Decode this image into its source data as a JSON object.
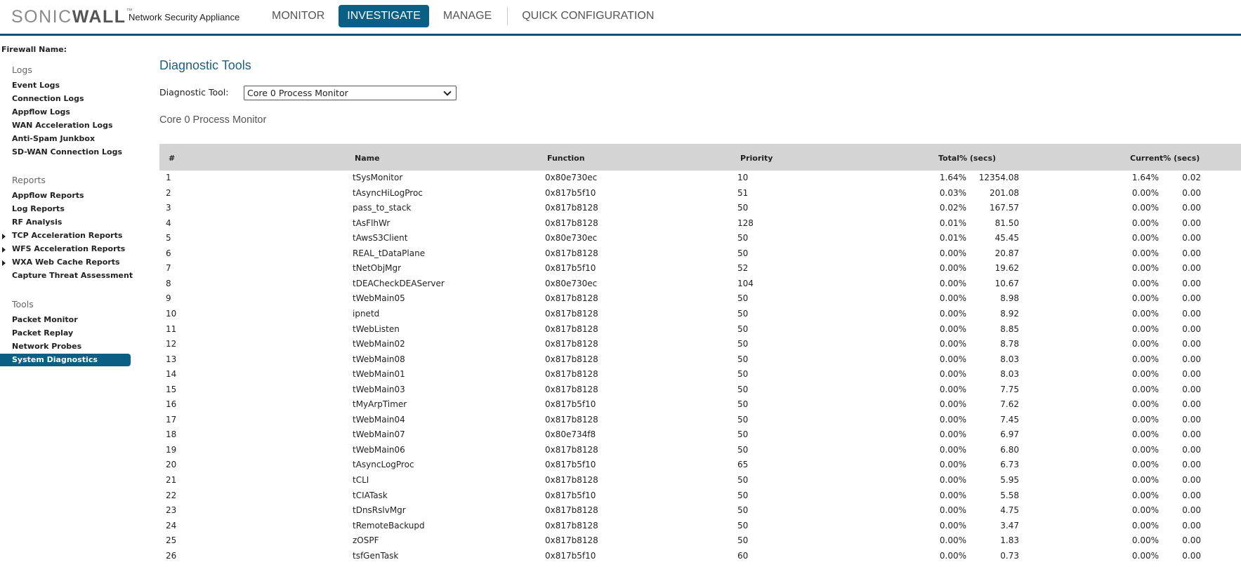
{
  "header": {
    "logo": "SONICWALL",
    "logo_parts": {
      "sonic": "SONIC",
      "wall": "WALL",
      "tm": "™"
    },
    "appliance": "Network Security Appliance",
    "nav": [
      "MONITOR",
      "INVESTIGATE",
      "MANAGE",
      "QUICK CONFIGURATION"
    ],
    "active_nav": "INVESTIGATE"
  },
  "sidebar": {
    "firewall_name_label": "Firewall Name:",
    "logs_heading": "Logs",
    "logs": [
      "Event Logs",
      "Connection Logs",
      "Appflow Logs",
      "WAN Acceleration Logs",
      "Anti-Spam Junkbox",
      "SD-WAN Connection Logs"
    ],
    "reports_heading": "Reports",
    "reports": [
      "Appflow Reports",
      "Log Reports",
      "RF Analysis",
      "TCP Acceleration Reports",
      "WFS Acceleration Reports",
      "WXA Web Cache Reports",
      "Capture Threat Assessment"
    ],
    "tools_heading": "Tools",
    "tools": [
      "Packet Monitor",
      "Packet Replay",
      "Network Probes",
      "System Diagnostics"
    ],
    "active_item": "System Diagnostics"
  },
  "main": {
    "title": "Diagnostic Tools",
    "tool_label": "Diagnostic Tool:",
    "tool_selected": "Core 0 Process Monitor",
    "subtitle": "Core 0 Process Monitor"
  },
  "table": {
    "headers": {
      "num": "#",
      "name": "Name",
      "function": "Function",
      "priority": "Priority",
      "total": "Total%  (secs)",
      "current": "Current%  (secs)"
    },
    "rows": [
      [
        "1",
        "tSysMonitor",
        "0x80e730ec",
        "10",
        "1.64%",
        "12354.08",
        "1.64%",
        "0.02"
      ],
      [
        "2",
        "tAsyncHiLogProc",
        "0x817b5f10",
        "51",
        "0.03%",
        "201.08",
        "0.00%",
        "0.00"
      ],
      [
        "3",
        "pass_to_stack",
        "0x817b8128",
        "50",
        "0.02%",
        "167.57",
        "0.00%",
        "0.00"
      ],
      [
        "4",
        "tAsFlhWr",
        "0x817b8128",
        "128",
        "0.01%",
        "81.50",
        "0.00%",
        "0.00"
      ],
      [
        "5",
        "tAwsS3Client",
        "0x80e730ec",
        "50",
        "0.01%",
        "45.45",
        "0.00%",
        "0.00"
      ],
      [
        "6",
        "REAL_tDataPlane",
        "0x817b8128",
        "50",
        "0.00%",
        "20.87",
        "0.00%",
        "0.00"
      ],
      [
        "7",
        "tNetObjMgr",
        "0x817b5f10",
        "52",
        "0.00%",
        "19.62",
        "0.00%",
        "0.00"
      ],
      [
        "8",
        "tDEACheckDEAServer",
        "0x80e730ec",
        "104",
        "0.00%",
        "10.67",
        "0.00%",
        "0.00"
      ],
      [
        "9",
        "tWebMain05",
        "0x817b8128",
        "50",
        "0.00%",
        "8.98",
        "0.00%",
        "0.00"
      ],
      [
        "10",
        "ipnetd",
        "0x817b8128",
        "50",
        "0.00%",
        "8.92",
        "0.00%",
        "0.00"
      ],
      [
        "11",
        "tWebListen",
        "0x817b8128",
        "50",
        "0.00%",
        "8.85",
        "0.00%",
        "0.00"
      ],
      [
        "12",
        "tWebMain02",
        "0x817b8128",
        "50",
        "0.00%",
        "8.78",
        "0.00%",
        "0.00"
      ],
      [
        "13",
        "tWebMain08",
        "0x817b8128",
        "50",
        "0.00%",
        "8.03",
        "0.00%",
        "0.00"
      ],
      [
        "14",
        "tWebMain01",
        "0x817b8128",
        "50",
        "0.00%",
        "8.03",
        "0.00%",
        "0.00"
      ],
      [
        "15",
        "tWebMain03",
        "0x817b8128",
        "50",
        "0.00%",
        "7.75",
        "0.00%",
        "0.00"
      ],
      [
        "16",
        "tMyArpTimer",
        "0x817b5f10",
        "50",
        "0.00%",
        "7.62",
        "0.00%",
        "0.00"
      ],
      [
        "17",
        "tWebMain04",
        "0x817b8128",
        "50",
        "0.00%",
        "7.45",
        "0.00%",
        "0.00"
      ],
      [
        "18",
        "tWebMain07",
        "0x80e734f8",
        "50",
        "0.00%",
        "6.97",
        "0.00%",
        "0.00"
      ],
      [
        "19",
        "tWebMain06",
        "0x817b8128",
        "50",
        "0.00%",
        "6.80",
        "0.00%",
        "0.00"
      ],
      [
        "20",
        "tAsyncLogProc",
        "0x817b5f10",
        "65",
        "0.00%",
        "6.73",
        "0.00%",
        "0.00"
      ],
      [
        "21",
        "tCLI",
        "0x817b8128",
        "50",
        "0.00%",
        "5.95",
        "0.00%",
        "0.00"
      ],
      [
        "22",
        "tCIATask",
        "0x817b5f10",
        "50",
        "0.00%",
        "5.58",
        "0.00%",
        "0.00"
      ],
      [
        "23",
        "tDnsRslvMgr",
        "0x817b8128",
        "50",
        "0.00%",
        "4.75",
        "0.00%",
        "0.00"
      ],
      [
        "24",
        "tRemoteBackupd",
        "0x817b8128",
        "50",
        "0.00%",
        "3.47",
        "0.00%",
        "0.00"
      ],
      [
        "25",
        "zOSPF",
        "0x817b8128",
        "50",
        "0.00%",
        "1.83",
        "0.00%",
        "0.00"
      ],
      [
        "26",
        "tsfGenTask",
        "0x817b5f10",
        "60",
        "0.00%",
        "0.73",
        "0.00%",
        "0.00"
      ]
    ]
  },
  "colors": {
    "accent": "#0a5f85",
    "header_line": "#0a5273",
    "logo_orange": "#f07d1a",
    "table_header": "#d4d4d4"
  }
}
